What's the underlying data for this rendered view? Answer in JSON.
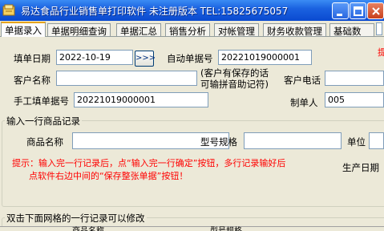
{
  "window": {
    "title": "易达食品行业销售单打印软件  未注册版本 TEL:15825675057"
  },
  "tabs": [
    {
      "label": "单据录入"
    },
    {
      "label": "单据明细查询"
    },
    {
      "label": "单据汇总"
    },
    {
      "label": "销售分析"
    },
    {
      "label": "对帐管理"
    },
    {
      "label": "财务收款管理"
    },
    {
      "label": "基础数"
    }
  ],
  "form": {
    "date_label": "填单日期",
    "date_value": "2022-10-19",
    "date_button": ">>>",
    "auto_no_label": "自动单据号",
    "auto_no_value": "20221019000001",
    "customer_label": "客户名称",
    "customer_value": "",
    "customer_hint": "(客户有保存的话\n可输拼音助记符)",
    "customer_phone_label": "客户电话",
    "customer_phone_value": "",
    "manual_no_label": "手工填单据号",
    "manual_no_value": "20221019000001",
    "maker_label": "制单人",
    "maker_value": "005",
    "side_mark": "提"
  },
  "item_entry": {
    "group_title": "输入一行商品记录",
    "product_label": "商品名称",
    "product_value": "",
    "spec_label": "型号规格",
    "spec_value": "",
    "unit_label": "单位",
    "unit_value": "",
    "hint": "提示：输入完一行记录后，点“输入完一行确定”按钮，多行记录输好后\n      点软件右边中间的“保存整张单据”按钮！",
    "production_date_label": "生产日期"
  },
  "grid": {
    "group_title": "双击下面网格的一行记录可以修改",
    "columns": [
      "商品名称",
      "型号规格"
    ]
  },
  "colors": {
    "titlebar": "#0a4ad0",
    "accent_tab": "#e6a51c",
    "hint_text": "#ff0000"
  }
}
